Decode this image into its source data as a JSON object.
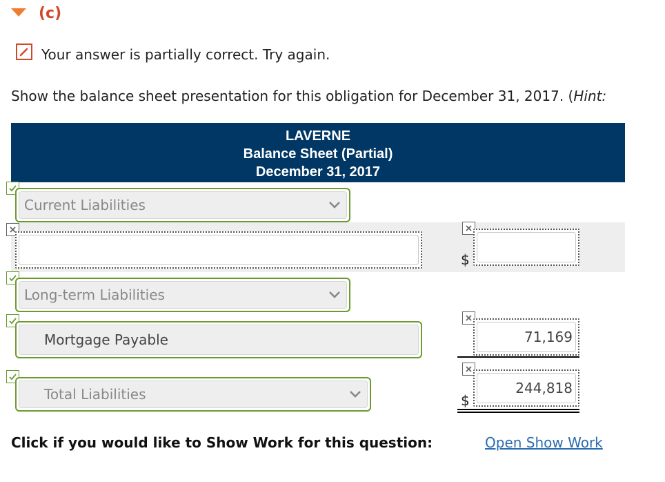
{
  "part": {
    "label": "(c)"
  },
  "feedback": {
    "text": "Your answer is partially correct.  Try again."
  },
  "instruction": {
    "text": "Show the balance sheet presentation for this obligation for December 31, 2017. (",
    "hint": "Hint:"
  },
  "table": {
    "company": "LAVERNE",
    "statement": "Balance Sheet (Partial)",
    "date": "December 31, 2017"
  },
  "rows": {
    "current_liabilities": {
      "label": "Current Liabilities",
      "status": "correct"
    },
    "blank_item": {
      "label": "",
      "status": "incorrect",
      "amount": "",
      "amount_status": "incorrect",
      "currency": "$"
    },
    "long_term_liabilities": {
      "label": "Long-term Liabilities",
      "status": "correct"
    },
    "mortgage_payable": {
      "label": "Mortgage Payable",
      "status": "correct",
      "amount": "71,169",
      "amount_status": "incorrect"
    },
    "total_liabilities": {
      "label": "Total Liabilities",
      "status": "correct",
      "amount": "244,818",
      "amount_status": "incorrect",
      "currency": "$"
    }
  },
  "show_work": {
    "label": "Click if you would like to Show Work for this question:",
    "link": "Open Show Work"
  },
  "colors": {
    "header_bg": "#003764",
    "correct": "#6b9a2f",
    "error": "#d2492a",
    "accent": "#f07d2e",
    "link": "#2a6cb0"
  },
  "icons": [
    "triangle-down-icon",
    "pencil-icon",
    "check-icon",
    "x-icon",
    "chevron-down-icon"
  ]
}
